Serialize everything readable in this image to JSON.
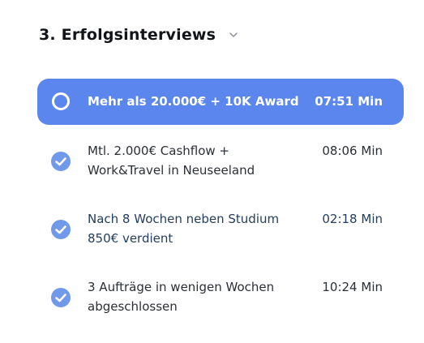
{
  "section": {
    "title": "3. Erfolgsinterviews"
  },
  "colors": {
    "accent": "#5b86ee",
    "check": "#7099ea",
    "text": "#2b2f36"
  },
  "lessons": [
    {
      "title": "Mehr als 20.000€ + 10K Award",
      "duration": "07:51 Min",
      "state": "active",
      "icon": "loading-ring-icon"
    },
    {
      "title": "Mtl. 2.000€ Cashflow + Work&Travel in Neuseeland",
      "duration": "08:06 Min",
      "state": "done",
      "icon": "check-circle-icon"
    },
    {
      "title": "Nach 8 Wochen neben Studium 850€ verdient",
      "duration": "02:18 Min",
      "state": "done",
      "icon": "check-circle-icon"
    },
    {
      "title": "3 Aufträge in wenigen Wochen abgeschlossen",
      "duration": "10:24 Min",
      "state": "done",
      "icon": "check-circle-icon"
    }
  ]
}
